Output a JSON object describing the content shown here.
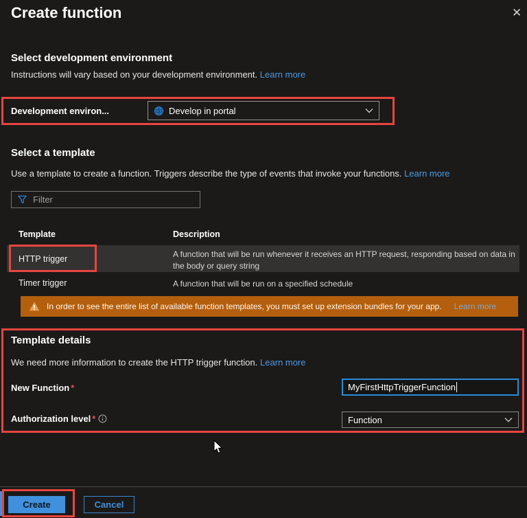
{
  "dialog": {
    "title": "Create function",
    "close_icon": "✕"
  },
  "dev_env_section": {
    "heading": "Select development environment",
    "description": "Instructions will vary based on your development environment.",
    "learn_more": "Learn more",
    "field_label": "Development environ...",
    "dropdown_value": "Develop in portal"
  },
  "template_section": {
    "heading": "Select a template",
    "description": "Use a template to create a function. Triggers describe the type of events that invoke your functions.",
    "learn_more": "Learn more",
    "filter_placeholder": "Filter",
    "table": {
      "columns": {
        "template": "Template",
        "description": "Description"
      },
      "rows": [
        {
          "template": "HTTP trigger",
          "description": "A function that will be run whenever it receives an HTTP request, responding based on data in the body or query string",
          "selected": true
        },
        {
          "template": "Timer trigger",
          "description": "A function that will be run on a specified schedule",
          "selected": false
        }
      ]
    },
    "warning": {
      "text": "In order to see the entire list of available function templates, you must set up extension bundles for your app.",
      "learn_more": "Learn more"
    }
  },
  "details_section": {
    "heading": "Template details",
    "description": "We need more information to create the HTTP trigger function.",
    "learn_more": "Learn more",
    "new_function": {
      "label": "New Function",
      "required": "*",
      "value": "MyFirstHttpTriggerFunction"
    },
    "authorization_level": {
      "label": "Authorization level",
      "required": "*",
      "value": "Function"
    }
  },
  "footer": {
    "create_label": "Create",
    "cancel_label": "Cancel"
  },
  "colors": {
    "background": "#1b1a19",
    "accent_blue": "#4a9ae4",
    "warning_orange": "#b45f0d",
    "annotation_red": "#e8453f",
    "primary_button_blue": "#4090dd",
    "selected_row_gray": "#343230",
    "focus_border_blue": "#2b8bd8"
  }
}
